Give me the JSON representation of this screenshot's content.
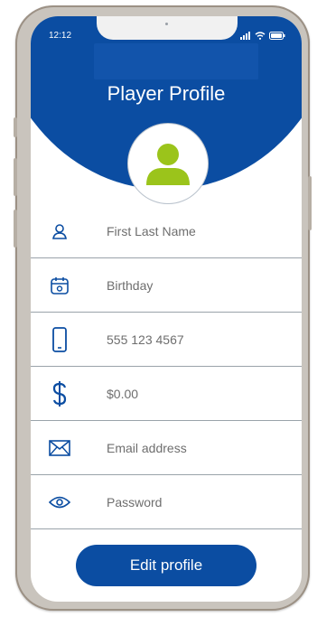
{
  "status": {
    "time": "12:12"
  },
  "header": {
    "title": "Player Profile"
  },
  "fields": [
    {
      "icon": "user-icon",
      "value": "First Last Name"
    },
    {
      "icon": "calendar-icon",
      "value": "Birthday"
    },
    {
      "icon": "phone-icon",
      "value": "555 123 4567"
    },
    {
      "icon": "dollar-icon",
      "value": "$0.00"
    },
    {
      "icon": "envelope-icon",
      "value": "Email address"
    },
    {
      "icon": "eye-icon",
      "value": "Password"
    }
  ],
  "actions": {
    "edit_label": "Edit profile"
  },
  "colors": {
    "primary": "#0b4da2",
    "avatar": "#9bc41b",
    "divider": "#9aa3aa"
  }
}
